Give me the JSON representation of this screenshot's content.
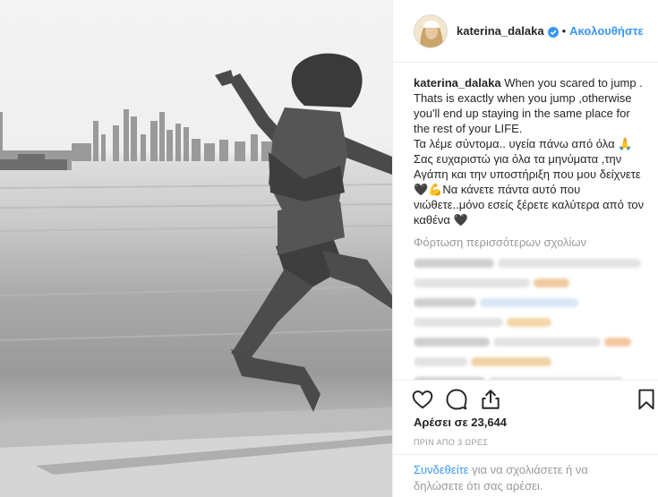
{
  "post": {
    "username": "katerina_dalaka",
    "follow_label": "Ακολουθήστε",
    "dot": "•",
    "caption_text": "When you scared to jump . Thats is exactly when you jump ,otherwise you'll end up staying in the same place for the rest of your LIFE.\nΤα λέμε σύντομα.. υγεία πάνω από όλα 🙏\nΣας ευχαριστώ για όλα τα μηνύματα ,την Αγάπη και την υποστήριξη που μου δείχνετε 🖤💪Να κάνετε πάντα αυτό που νιώθετε..μόνο εσείς ξέρετε καλύτερα από τον καθένα 🖤",
    "load_more": "Φόρτωση περισσότερων σχολίων",
    "likes": "Αρέσει σε 23,644",
    "time": "ΠΡΙΝ ΑΠΟ 3 ΩΡΕΣ",
    "login_link": "Συνδεθείτε",
    "login_rest": " για να σχολιάσετε ή να δηλώσετε ότι σας αρέσει."
  },
  "icons": {
    "verified": "verified-badge-icon",
    "like": "heart-icon",
    "comment": "comment-bubble-icon",
    "share": "share-icon",
    "save": "bookmark-icon"
  },
  "colors": {
    "accent": "#3897f0",
    "text": "#262626",
    "muted": "#999999",
    "border": "#efefef"
  }
}
